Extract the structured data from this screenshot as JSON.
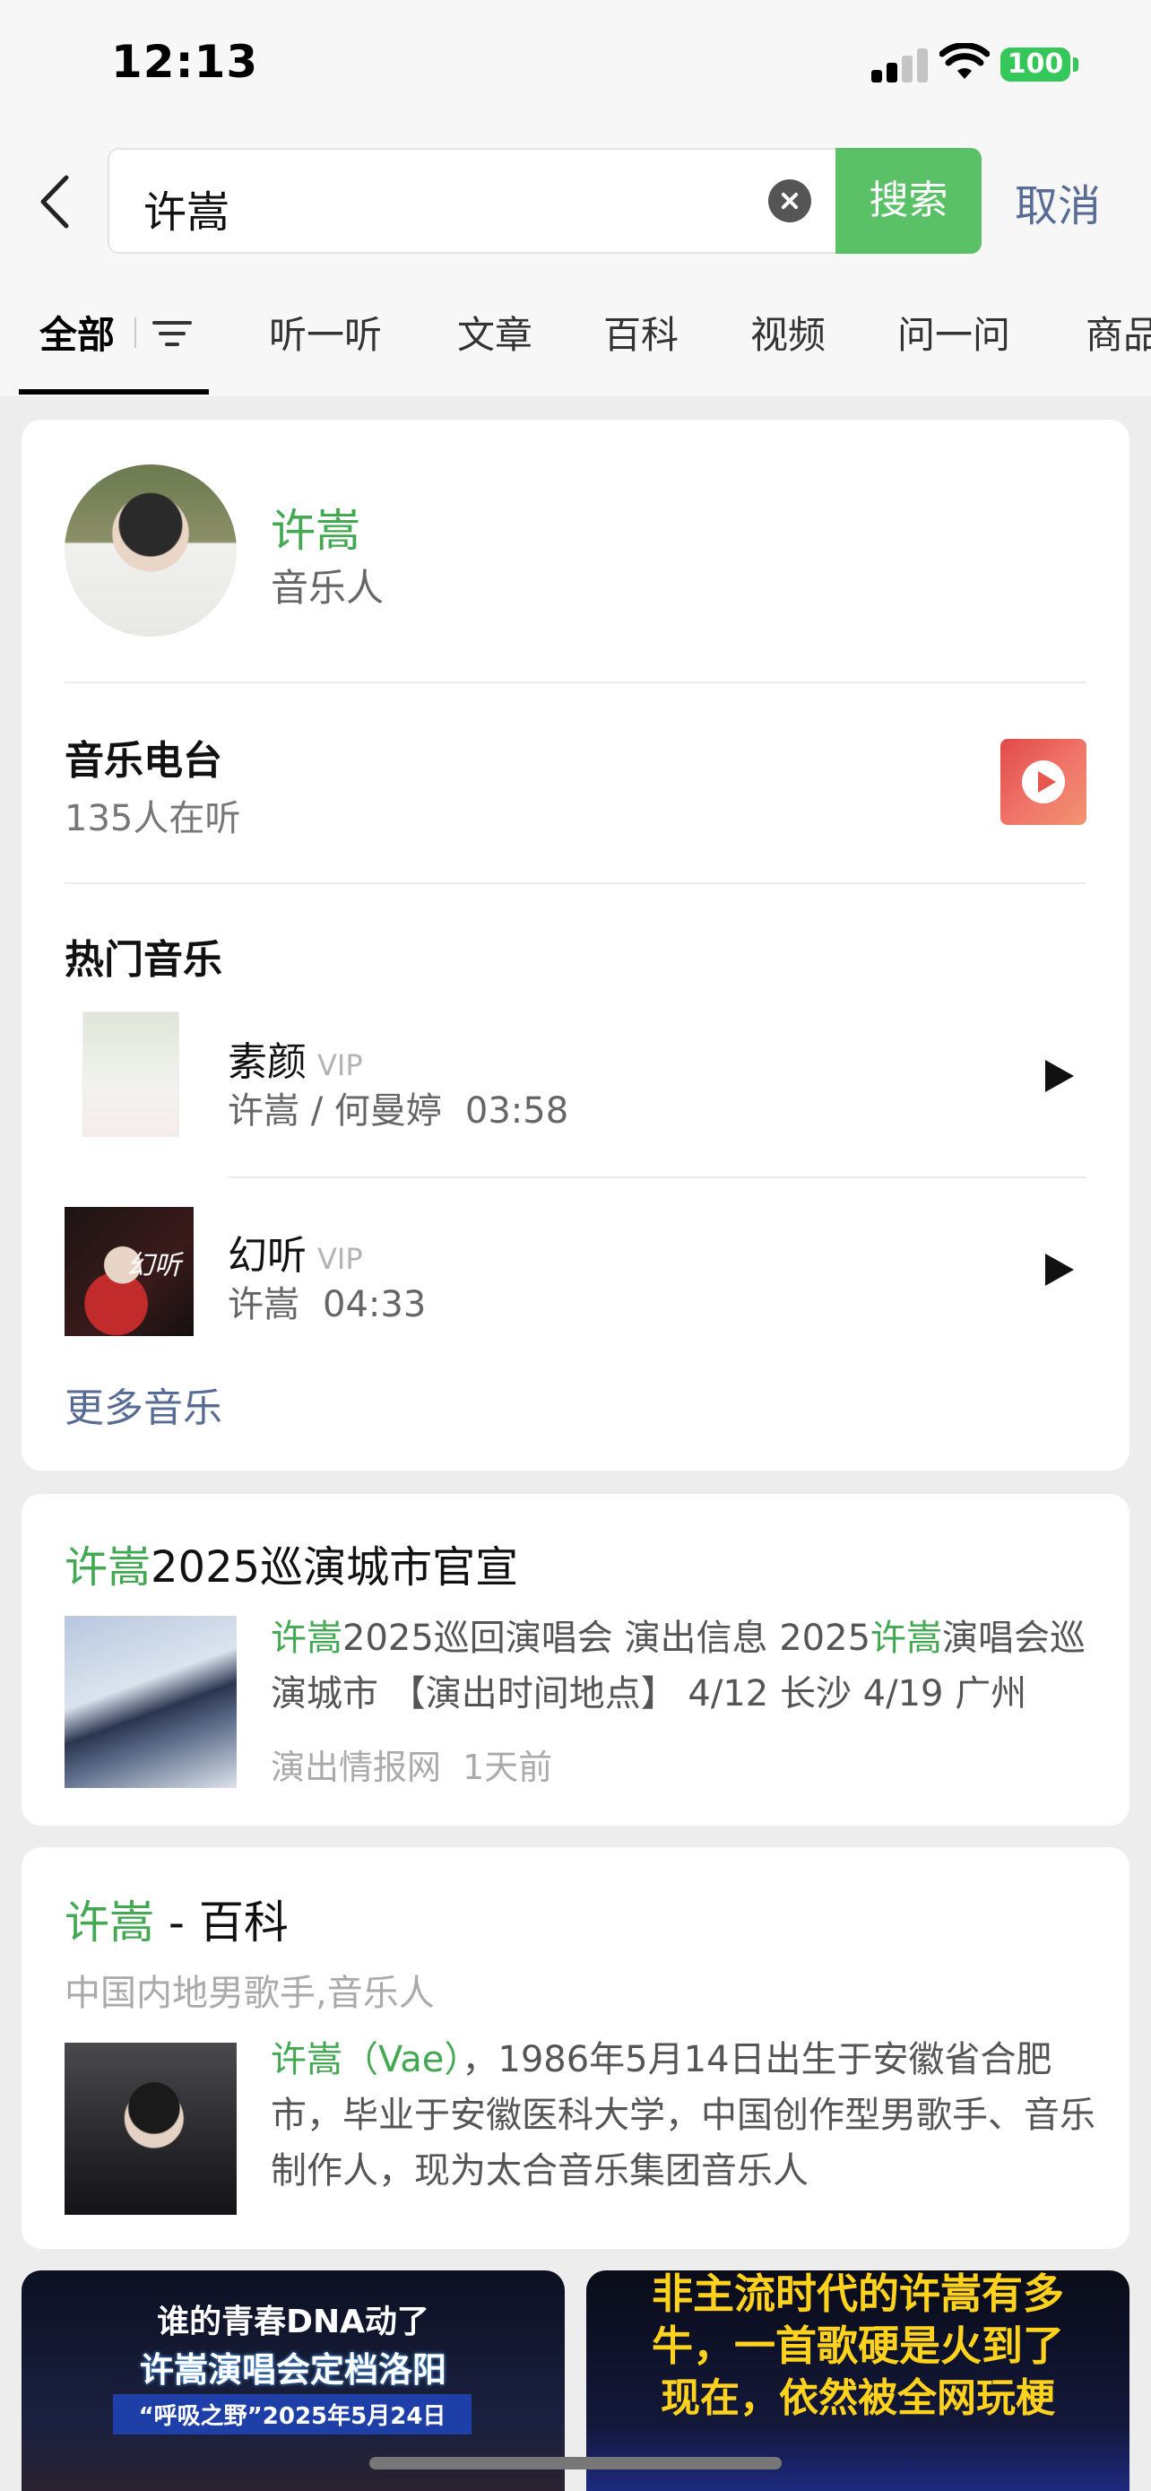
{
  "status_bar": {
    "time": "12:13",
    "battery": "100"
  },
  "search": {
    "query": "许嵩",
    "search_label": "搜索",
    "cancel_label": "取消"
  },
  "tabs": [
    {
      "label": "全部"
    },
    {
      "label": "听一听"
    },
    {
      "label": "文章"
    },
    {
      "label": "百科"
    },
    {
      "label": "视频"
    },
    {
      "label": "问一问"
    },
    {
      "label": "商品"
    }
  ],
  "profile": {
    "name": "许嵩",
    "role": "音乐人"
  },
  "radio": {
    "title": "音乐电台",
    "listeners": "135人在听"
  },
  "hot_music": {
    "title": "热门音乐",
    "songs": [
      {
        "title": "素颜",
        "vip": "VIP",
        "artists": "许嵩 / 何曼婷",
        "duration": "03:58"
      },
      {
        "title": "幻听",
        "vip": "VIP",
        "artists": "许嵩",
        "duration": "04:33"
      }
    ],
    "more_label": "更多音乐"
  },
  "article": {
    "title_hl": "许嵩",
    "title_rest": "2025巡演城市官宣",
    "body_hl1": "许嵩",
    "body_mid": "2025巡回演唱会 演出信息 2025",
    "body_hl2": "许嵩",
    "body_rest": "演唱会巡演城市 【演出时间地点】 4/12 长沙 4/19 广州",
    "source": "演出情报网",
    "time": "1天前"
  },
  "baike": {
    "title_hl": "许嵩",
    "title_rest": " - 百科",
    "subtitle": "中国内地男歌手,音乐人",
    "body_hl": "许嵩",
    "body_paren": "（Vae）",
    "body_rest": "，1986年5月14日出生于安徽省合肥市，毕业于安徽医科大学，中国创作型男歌手、音乐制作人，现为太合音乐集团音乐人"
  },
  "videos": [
    {
      "line1": "谁的青春DNA动了",
      "line2": "许嵩演唱会定档洛阳",
      "line3": "“呼吸之野”2025年5月24日"
    },
    {
      "line1": "非主流时代的许嵩有多",
      "line2": "牛，一首歌硬是火到了",
      "line3": "现在，依然被全网玩梗"
    }
  ],
  "colors": {
    "accent_green": "#5ac167",
    "highlight_green": "#43a852",
    "link_blue": "#576b95"
  }
}
